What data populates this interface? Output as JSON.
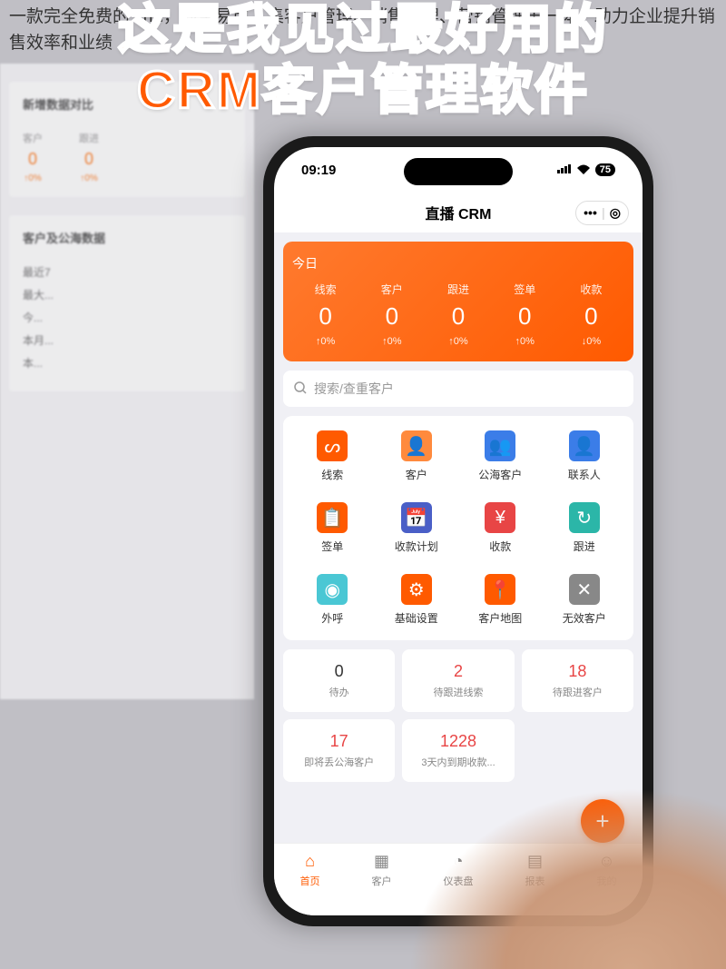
{
  "bg_description": "一款完全免费的 crm，简单易用，集客户管理、销售管理、营销管理于一体，助力企业提升销售效率和业绩",
  "overlay": {
    "line1": "这是我见过最好用的",
    "line2": "CRM客户管理软件"
  },
  "bg_dashboard": {
    "card1_title": "新增数据对比",
    "stat1_label": "客户",
    "stat1_value": "0",
    "stat1_pct": "↑0%",
    "stat2_label": "跟进",
    "stat2_value": "0",
    "stat2_pct": "↑0%",
    "card2_title": "客户及公海数据",
    "items": [
      "最近7",
      "最大...",
      "今...",
      "本月...",
      "本..."
    ]
  },
  "status": {
    "time": "09:19",
    "battery": "75"
  },
  "header": {
    "title": "直播 CRM"
  },
  "today": {
    "label": "今日",
    "stats": [
      {
        "label": "线索",
        "value": "0",
        "pct": "↑0%"
      },
      {
        "label": "客户",
        "value": "0",
        "pct": "↑0%"
      },
      {
        "label": "跟进",
        "value": "0",
        "pct": "↑0%"
      },
      {
        "label": "签单",
        "value": "0",
        "pct": "↑0%"
      },
      {
        "label": "收款",
        "value": "0",
        "pct": "↓0%"
      }
    ]
  },
  "search": {
    "placeholder": "搜索/查重客户"
  },
  "grid": [
    {
      "label": "线索",
      "color": "#ff5a00",
      "glyph": "ᔕ"
    },
    {
      "label": "客户",
      "color": "#ff8a3d",
      "glyph": "👤"
    },
    {
      "label": "公海客户",
      "color": "#3b7de8",
      "glyph": "👥"
    },
    {
      "label": "联系人",
      "color": "#3b7de8",
      "glyph": "👤"
    },
    {
      "label": "签单",
      "color": "#ff5a00",
      "glyph": "📋"
    },
    {
      "label": "收款计划",
      "color": "#4a5fc7",
      "glyph": "📅"
    },
    {
      "label": "收款",
      "color": "#e84545",
      "glyph": "¥"
    },
    {
      "label": "跟进",
      "color": "#2bb6a8",
      "glyph": "↻"
    },
    {
      "label": "外呼",
      "color": "#4ac7d4",
      "glyph": "◉"
    },
    {
      "label": "基础设置",
      "color": "#ff5a00",
      "glyph": "⚙"
    },
    {
      "label": "客户地图",
      "color": "#ff5a00",
      "glyph": "📍"
    },
    {
      "label": "无效客户",
      "color": "#888",
      "glyph": "✕"
    }
  ],
  "tiles": [
    {
      "value": "0",
      "label": "待办",
      "color": "#333"
    },
    {
      "value": "2",
      "label": "待跟进线索",
      "color": "#e84545"
    },
    {
      "value": "18",
      "label": "待跟进客户",
      "color": "#e84545"
    },
    {
      "value": "17",
      "label": "即将丢公海客户",
      "color": "#e84545"
    },
    {
      "value": "1228",
      "label": "3天内到期收款...",
      "color": "#e84545"
    }
  ],
  "tabs": [
    {
      "label": "首页",
      "glyph": "⌂",
      "active": true
    },
    {
      "label": "客户",
      "glyph": "▦",
      "active": false
    },
    {
      "label": "仪表盘",
      "glyph": "◔",
      "active": false
    },
    {
      "label": "报表",
      "glyph": "▤",
      "active": false
    },
    {
      "label": "我的",
      "glyph": "☺",
      "active": false
    }
  ]
}
